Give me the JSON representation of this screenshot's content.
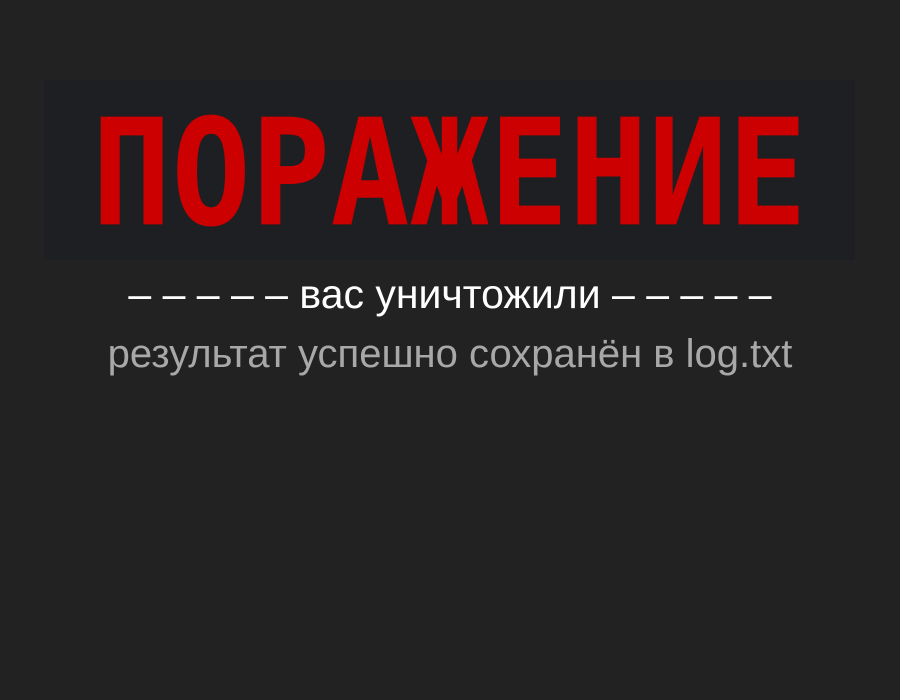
{
  "screen": {
    "title": "ПОРАЖЕНИЕ",
    "subtitle": "– – – – – вас уничтожили – – – – –",
    "status": "результат успешно сохранён в log.txt"
  },
  "colors": {
    "background": "#222222",
    "banner_background": "#1e1f22",
    "title": "#cc0000",
    "subtitle": "#ffffff",
    "status": "#a8a8a8"
  }
}
